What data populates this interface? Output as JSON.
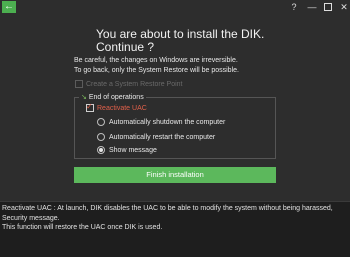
{
  "titlebar": {
    "back_icon": "←",
    "help_label": "?",
    "minimize_label": "—",
    "close_label": "✕"
  },
  "heading": {
    "line1": "You are about to install the DIK.",
    "line2": "Continue ?"
  },
  "warning": {
    "line1": "Be careful, the changes on Windows are irreversible.",
    "line2": "To go back, only the System Restore will be possible."
  },
  "restore_point": {
    "label": "Create a System Restore Point",
    "checked": false,
    "enabled": false
  },
  "end_of_operations": {
    "arrow": "↘",
    "legend": "End of operations",
    "reactivate_uac": {
      "label": "Reactivate UAC",
      "checked": true
    },
    "options": [
      {
        "label": "Automatically shutdown the computer",
        "selected": false
      },
      {
        "label": "Automatically restart the computer",
        "selected": false
      },
      {
        "label": "Show message",
        "selected": true
      }
    ]
  },
  "finish_button": {
    "label": "Finish installation"
  },
  "description": {
    "line1": "Reactivate UAC : At launch, DIK disables the UAC to be able to modify the system without being harassed,",
    "line2": "Security message.",
    "line3": "This function will restore the UAC once DIK is used."
  },
  "colors": {
    "background": "#2d2d2d",
    "accent_green": "#5cb85c",
    "uac_red": "#e2604a",
    "bottom_panel": "#1e1e1e"
  }
}
